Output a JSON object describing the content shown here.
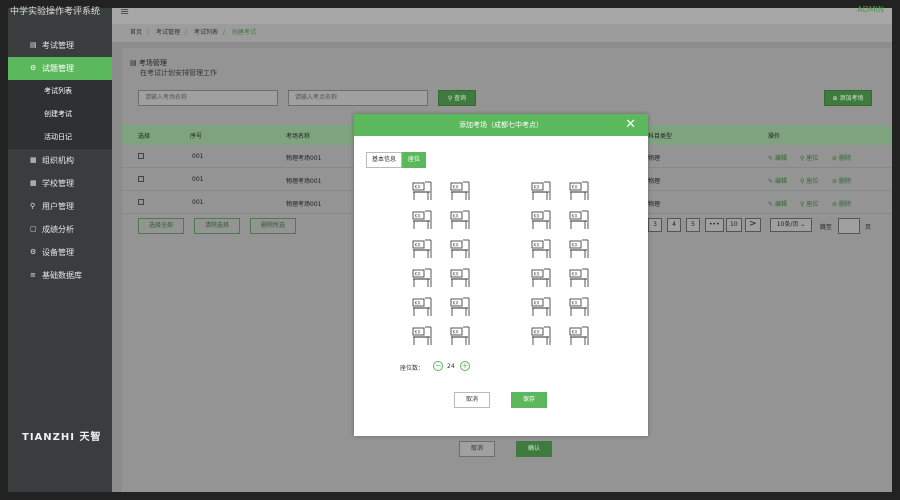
{
  "app": {
    "title": "中学实验操作考评系统",
    "admin": "ADMIN"
  },
  "sidebar": {
    "items": [
      {
        "icon": "exam-icon",
        "glyph": "▤",
        "label": "考试管理"
      },
      {
        "icon": "question-bank-icon",
        "glyph": "⚙",
        "label": "试题管理"
      },
      {
        "icon": "org-icon",
        "glyph": "▦",
        "label": "组织机构"
      },
      {
        "icon": "school-icon",
        "glyph": "▦",
        "label": "学校管理"
      },
      {
        "icon": "user-icon",
        "glyph": "⚲",
        "label": "用户管理"
      },
      {
        "icon": "analysis-icon",
        "glyph": "▢",
        "label": "成绩分析"
      },
      {
        "icon": "device-icon",
        "glyph": "⚙",
        "label": "设备管理"
      },
      {
        "icon": "database-icon",
        "glyph": "≡",
        "label": "基础数据库"
      }
    ],
    "sub_items": [
      "考试列表",
      "创建考试",
      "活动日记"
    ],
    "logo": "TIANZHI 天智"
  },
  "breadcrumb": {
    "items": [
      "首页",
      "考试管理",
      "考试列表"
    ],
    "current": "创建考试"
  },
  "header": {
    "title": "考场管理",
    "subtitle": "在考试计划安排管理工作"
  },
  "filters": {
    "room_name_placeholder": "请输入考场名称",
    "point_name_placeholder": "请输入考点名称",
    "search_label": "查询",
    "add_label": "添加考场"
  },
  "table": {
    "columns": [
      "选择",
      "序号",
      "考场名称",
      "科目类型",
      "操作"
    ],
    "rows": [
      {
        "seq": "001",
        "name": "物理考场001",
        "subject": "物理"
      },
      {
        "seq": "001",
        "name": "物理考场001",
        "subject": "物理"
      },
      {
        "seq": "001",
        "name": "物理考场001",
        "subject": "物理"
      }
    ],
    "ops": {
      "edit": "编辑",
      "seat": "座位",
      "delete": "删除"
    }
  },
  "actions": {
    "select_all": "选择全部",
    "clear": "清除选择",
    "delete_selected": "删除所选"
  },
  "pagination": {
    "pages": [
      "3",
      "4",
      "5",
      "•••",
      "10"
    ],
    "next": ">",
    "per_page": "10条/页",
    "jump_label": "跳至",
    "page_suffix": "页"
  },
  "bottom": {
    "cancel": "取消",
    "next": "确认"
  },
  "modal": {
    "title": "添加考场（成都七中考点）",
    "tabs": [
      "基本信息",
      "座位"
    ],
    "seat_label": "座位数：",
    "seat_count": "24",
    "cancel": "取消",
    "save": "保存",
    "accent": "#5cb85c"
  }
}
